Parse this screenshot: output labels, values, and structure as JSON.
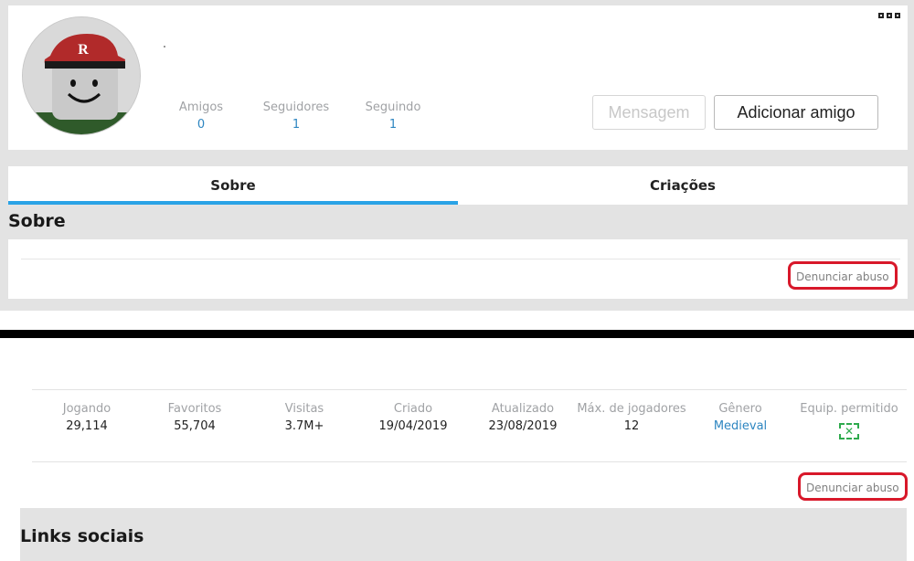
{
  "profile": {
    "more_icon": "more-options-icon",
    "stats": [
      {
        "label": "Amigos",
        "value": "0"
      },
      {
        "label": "Seguidores",
        "value": "1"
      },
      {
        "label": "Seguindo",
        "value": "1"
      }
    ],
    "message_button": "Mensagem",
    "add_friend_button": "Adicionar amigo"
  },
  "tabs": [
    {
      "label": "Sobre",
      "active": true
    },
    {
      "label": "Criações",
      "active": false
    }
  ],
  "about": {
    "title": "Sobre",
    "report_link": "Denunciar abuso"
  },
  "game": {
    "stats": [
      {
        "label": "Jogando",
        "value": "29,114"
      },
      {
        "label": "Favoritos",
        "value": "55,704"
      },
      {
        "label": "Visitas",
        "value": "3.7M+"
      },
      {
        "label": "Criado",
        "value": "19/04/2019"
      },
      {
        "label": "Atualizado",
        "value": "23/08/2019"
      },
      {
        "label": "Máx. de jogadores",
        "value": "12"
      },
      {
        "label": "Gênero",
        "value": "Medieval"
      },
      {
        "label": "Equip. permitido",
        "value": "✕"
      }
    ],
    "report_link": "Denunciar abuso"
  },
  "social": {
    "title": "Links sociais"
  },
  "colors": {
    "accent": "#2aa3e6",
    "link": "#2e86c1",
    "highlight": "#d8182a",
    "gear_allowed": "#2eaa4d"
  }
}
